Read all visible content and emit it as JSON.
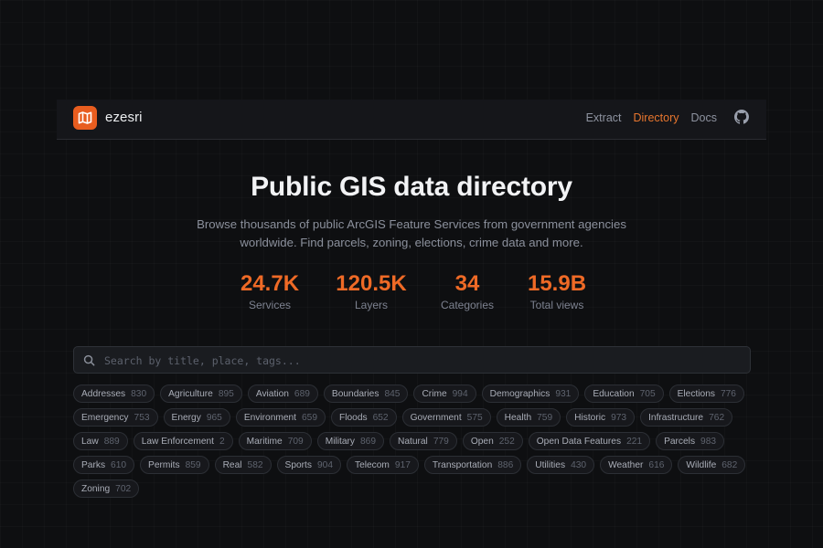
{
  "brand": {
    "name": "ezesri"
  },
  "nav": {
    "links": [
      "Extract",
      "Directory",
      "Docs"
    ],
    "active": "Directory"
  },
  "hero": {
    "title": "Public GIS data directory",
    "subtitle_line1": "Browse thousands of public ArcGIS Feature Services from government agencies",
    "subtitle_line2": "worldwide. Find parcels, zoning, elections, crime data and more."
  },
  "stats": [
    {
      "value": "24.7K",
      "label": "Services"
    },
    {
      "value": "120.5K",
      "label": "Layers"
    },
    {
      "value": "34",
      "label": "Categories"
    },
    {
      "value": "15.9B",
      "label": "Total views"
    }
  ],
  "search": {
    "placeholder": "Search by title, place, tags..."
  },
  "tags": [
    {
      "name": "Addresses",
      "count": "830"
    },
    {
      "name": "Agriculture",
      "count": "895"
    },
    {
      "name": "Aviation",
      "count": "689"
    },
    {
      "name": "Boundaries",
      "count": "845"
    },
    {
      "name": "Crime",
      "count": "994"
    },
    {
      "name": "Demographics",
      "count": "931"
    },
    {
      "name": "Education",
      "count": "705"
    },
    {
      "name": "Elections",
      "count": "776"
    },
    {
      "name": "Emergency",
      "count": "753"
    },
    {
      "name": "Energy",
      "count": "965"
    },
    {
      "name": "Environment",
      "count": "659"
    },
    {
      "name": "Floods",
      "count": "652"
    },
    {
      "name": "Government",
      "count": "575"
    },
    {
      "name": "Health",
      "count": "759"
    },
    {
      "name": "Historic",
      "count": "973"
    },
    {
      "name": "Infrastructure",
      "count": "762"
    },
    {
      "name": "Law",
      "count": "889"
    },
    {
      "name": "Law Enforcement",
      "count": "2"
    },
    {
      "name": "Maritime",
      "count": "709"
    },
    {
      "name": "Military",
      "count": "869"
    },
    {
      "name": "Natural",
      "count": "779"
    },
    {
      "name": "Open",
      "count": "252"
    },
    {
      "name": "Open Data Features",
      "count": "221"
    },
    {
      "name": "Parcels",
      "count": "983"
    },
    {
      "name": "Parks",
      "count": "610"
    },
    {
      "name": "Permits",
      "count": "859"
    },
    {
      "name": "Real",
      "count": "582"
    },
    {
      "name": "Sports",
      "count": "904"
    },
    {
      "name": "Telecom",
      "count": "917"
    },
    {
      "name": "Transportation",
      "count": "886"
    },
    {
      "name": "Utilities",
      "count": "430"
    },
    {
      "name": "Weather",
      "count": "616"
    },
    {
      "name": "Wildlife",
      "count": "682"
    },
    {
      "name": "Zoning",
      "count": "702"
    }
  ],
  "colors": {
    "accent": "#e8762e",
    "stat": "#ef6a26",
    "logo": "#e85d1f",
    "background": "#0e0f11"
  },
  "icons": {
    "logo": "map-icon",
    "github": "github-icon",
    "search": "search-icon"
  }
}
